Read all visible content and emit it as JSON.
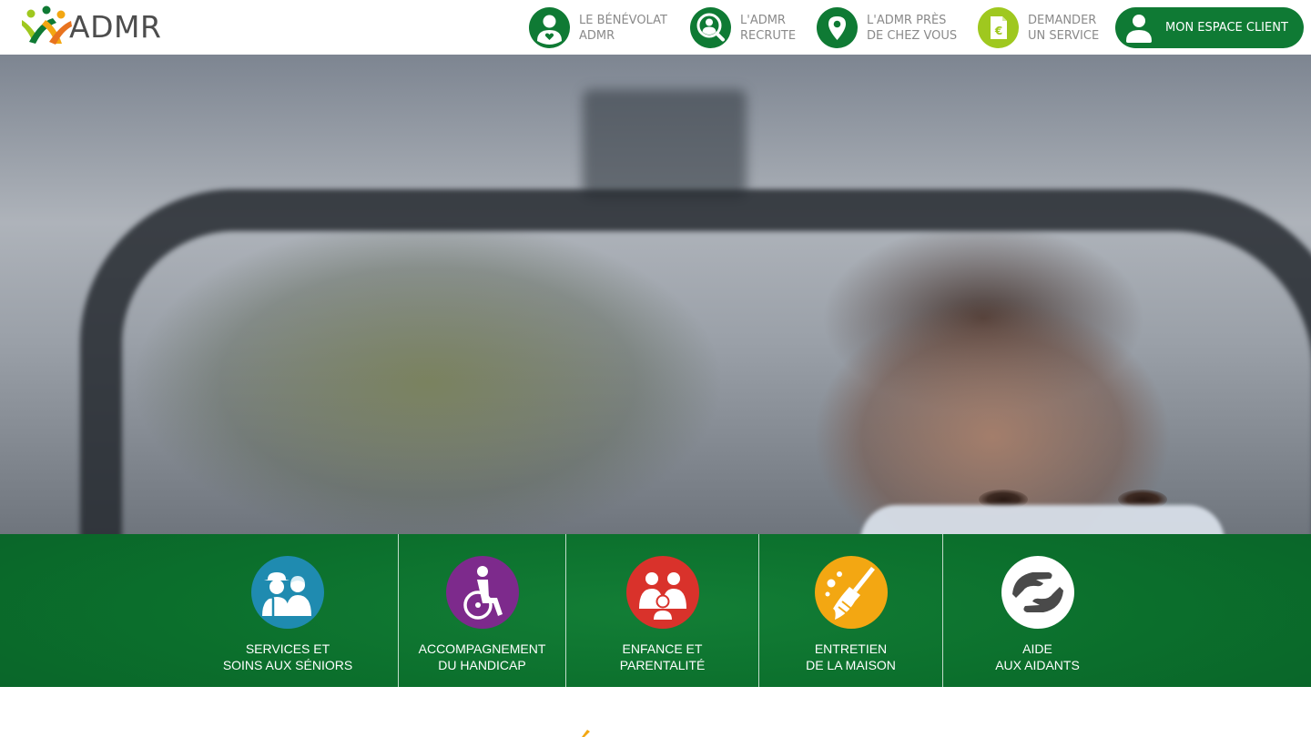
{
  "brand": {
    "name": "ADMR"
  },
  "nav": [
    {
      "id": "benevolat",
      "line1": "LE BÉNÉVOLAT",
      "line2": "ADMR",
      "icon": "volunteer-heart-icon"
    },
    {
      "id": "recrute",
      "line1": "L'ADMR",
      "line2": "RECRUTE",
      "icon": "recruit-search-icon"
    },
    {
      "id": "pres",
      "line1": "L'ADMR PRÈS",
      "line2": "DE CHEZ VOUS",
      "icon": "location-pin-icon"
    },
    {
      "id": "service",
      "line1": "DEMANDER",
      "line2": "UN SERVICE",
      "icon": "euro-document-icon"
    }
  ],
  "client_button": {
    "label": "MON ESPACE CLIENT",
    "icon": "user-icon"
  },
  "services": [
    {
      "id": "seniors",
      "line1": "SERVICES ET",
      "line2": "SOINS AUX SÉNIORS",
      "color": "#1f8bb0",
      "icon": "seniors-icon"
    },
    {
      "id": "handicap",
      "line1": "ACCOMPAGNEMENT",
      "line2": "DU HANDICAP",
      "color": "#7d2a8c",
      "icon": "wheelchair-icon"
    },
    {
      "id": "enfance",
      "line1": "ENFANCE ET",
      "line2": "PARENTALITÉ",
      "color": "#d9322b",
      "icon": "family-icon"
    },
    {
      "id": "entretien",
      "line1": "ENTRETIEN",
      "line2": "DE LA MAISON",
      "color": "#f3a712",
      "icon": "broom-icon"
    },
    {
      "id": "aidants",
      "line1": "AIDE",
      "line2": "AUX AIDANTS",
      "color": "#ffffff",
      "icon": "helping-hands-icon"
    }
  ],
  "colors": {
    "primary": "#0f7a34",
    "lime": "#9fc81f",
    "text_gray": "#8a8a8a"
  }
}
